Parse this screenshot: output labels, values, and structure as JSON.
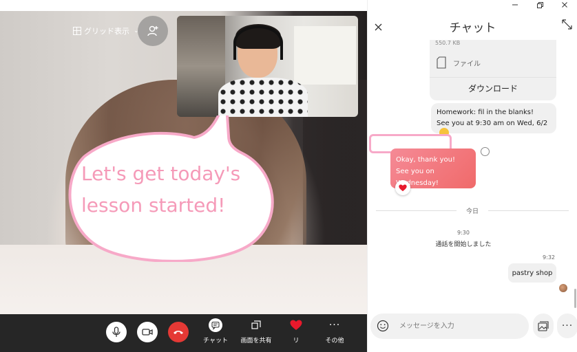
{
  "video": {
    "grid_view_label": "グリッド表示",
    "speech_text": "Let's get today's lesson started!"
  },
  "controls": {
    "chat_label": "チャット",
    "share_label": "画面を共有",
    "react_label": "リ",
    "more_label": "その他"
  },
  "chat": {
    "title": "チャット",
    "file_size": "550.7 KB",
    "file_label": "ファイル",
    "download_label": "ダウンロード",
    "homework_line1": "Homework: fil in the blanks!",
    "homework_line2": "See you at 9:30 am on Wed, 6/2",
    "reply_line1": "Okay, thank you!",
    "reply_line2": "See you on Wednesday!",
    "day_label": "今日",
    "call_time": "9:30",
    "call_started": "通話を開始しました",
    "last_time": "9:32",
    "last_message": "pastry shop",
    "input_placeholder": "メッセージを入力"
  },
  "colors": {
    "accent_pink": "#f59ab8",
    "end_call_red": "#e53935",
    "outgoing_bubble": "#f06a6a",
    "controls_bg": "#262626"
  }
}
